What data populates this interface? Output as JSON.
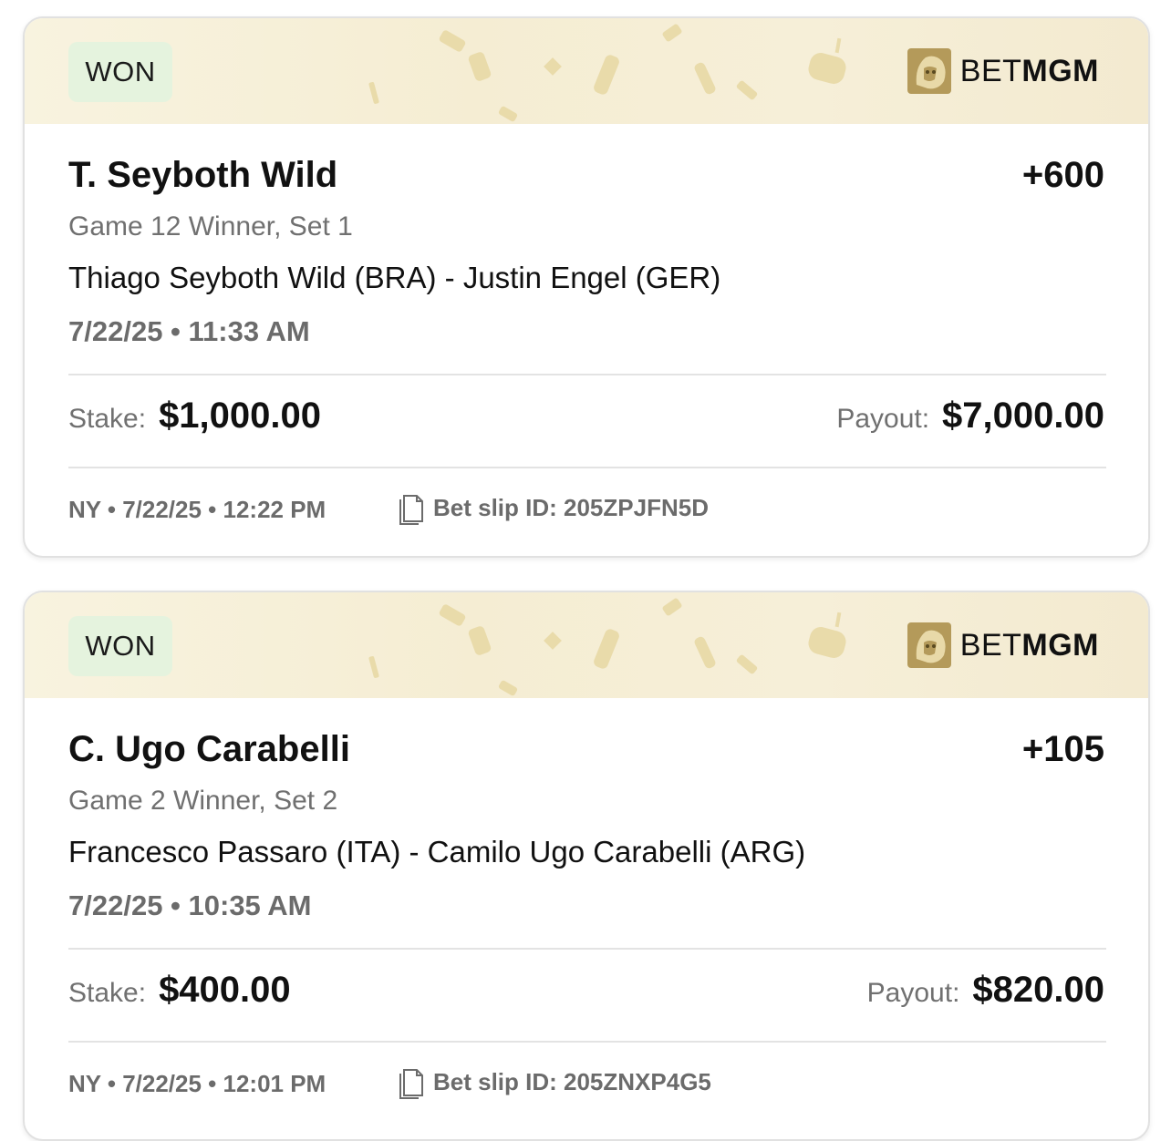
{
  "bets": [
    {
      "status": "WON",
      "brand": {
        "bet": "BET",
        "mgm": "MGM"
      },
      "selection": "T. Seyboth Wild",
      "odds": "+600",
      "market": "Game 12 Winner, Set 1",
      "event": "Thiago Seyboth Wild (BRA) - Justin Engel (GER)",
      "event_time": "7/22/25 • 11:33 AM",
      "stake_label": "Stake:",
      "stake": "$1,000.00",
      "payout_label": "Payout:",
      "payout": "$7,000.00",
      "placed": "NY • 7/22/25 • 12:22 PM",
      "slip_id": "Bet slip ID: 205ZPJFN5D"
    },
    {
      "status": "WON",
      "brand": {
        "bet": "BET",
        "mgm": "MGM"
      },
      "selection": "C. Ugo Carabelli",
      "odds": "+105",
      "market": "Game 2 Winner, Set 2",
      "event": "Francesco Passaro (ITA) - Camilo Ugo Carabelli (ARG)",
      "event_time": "7/22/25 • 10:35 AM",
      "stake_label": "Stake:",
      "stake": "$400.00",
      "payout_label": "Payout:",
      "payout": "$820.00",
      "placed": "NY • 7/22/25 • 12:01 PM",
      "slip_id": "Bet slip ID: 205ZNXP4G5"
    }
  ],
  "colors": {
    "won_badge_bg": "#e5f3de",
    "banner_bg": "#f6efd8",
    "brand_gold": "#b49a5a",
    "muted_text": "#707070"
  },
  "icons": {
    "brand_logo": "lion-icon",
    "copy": "copy-icon"
  }
}
